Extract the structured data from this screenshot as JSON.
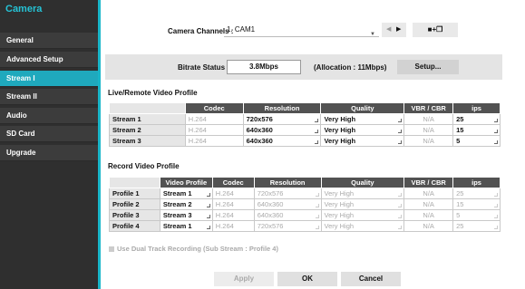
{
  "sidebar": {
    "title": "Camera",
    "items": [
      "General",
      "Advanced Setup",
      "Stream I",
      "Stream II",
      "Audio",
      "SD Card",
      "Upgrade"
    ],
    "active_index": 2
  },
  "channels": {
    "label": "Camera Channels :",
    "value": "1. CAM1",
    "split_label": "■+❐"
  },
  "bitrate": {
    "label": "Bitrate Status :",
    "value": "3.8Mbps",
    "allocation": "(Allocation : 11Mbps)",
    "setup_label": "Setup..."
  },
  "live": {
    "title": "Live/Remote Video Profile",
    "headers": [
      "",
      "Codec",
      "Resolution",
      "Quality",
      "VBR / CBR",
      "ips"
    ],
    "rows": [
      [
        "Stream 1",
        "H.264",
        "720x576",
        "Very High",
        "N/A",
        "25"
      ],
      [
        "Stream 2",
        "H.264",
        "640x360",
        "Very High",
        "N/A",
        "15"
      ],
      [
        "Stream 3",
        "H.264",
        "640x360",
        "Very High",
        "N/A",
        "5"
      ]
    ]
  },
  "record": {
    "title": "Record Video Profile",
    "headers": [
      "",
      "Video Profile",
      "Codec",
      "Resolution",
      "Quality",
      "VBR / CBR",
      "ips"
    ],
    "rows": [
      [
        "Profile 1",
        "Stream 1",
        "H.264",
        "720x576",
        "Very High",
        "N/A",
        "25"
      ],
      [
        "Profile 2",
        "Stream 2",
        "H.264",
        "640x360",
        "Very High",
        "N/A",
        "15"
      ],
      [
        "Profile 3",
        "Stream 3",
        "H.264",
        "640x360",
        "Very High",
        "N/A",
        "5"
      ],
      [
        "Profile 4",
        "Stream 1",
        "H.264",
        "720x576",
        "Very High",
        "N/A",
        "25"
      ]
    ]
  },
  "dual_track": {
    "label": "Use Dual Track Recording  (Sub Stream : Profile 4)",
    "checked": false
  },
  "buttons": {
    "apply": "Apply",
    "ok": "OK",
    "cancel": "Cancel"
  }
}
